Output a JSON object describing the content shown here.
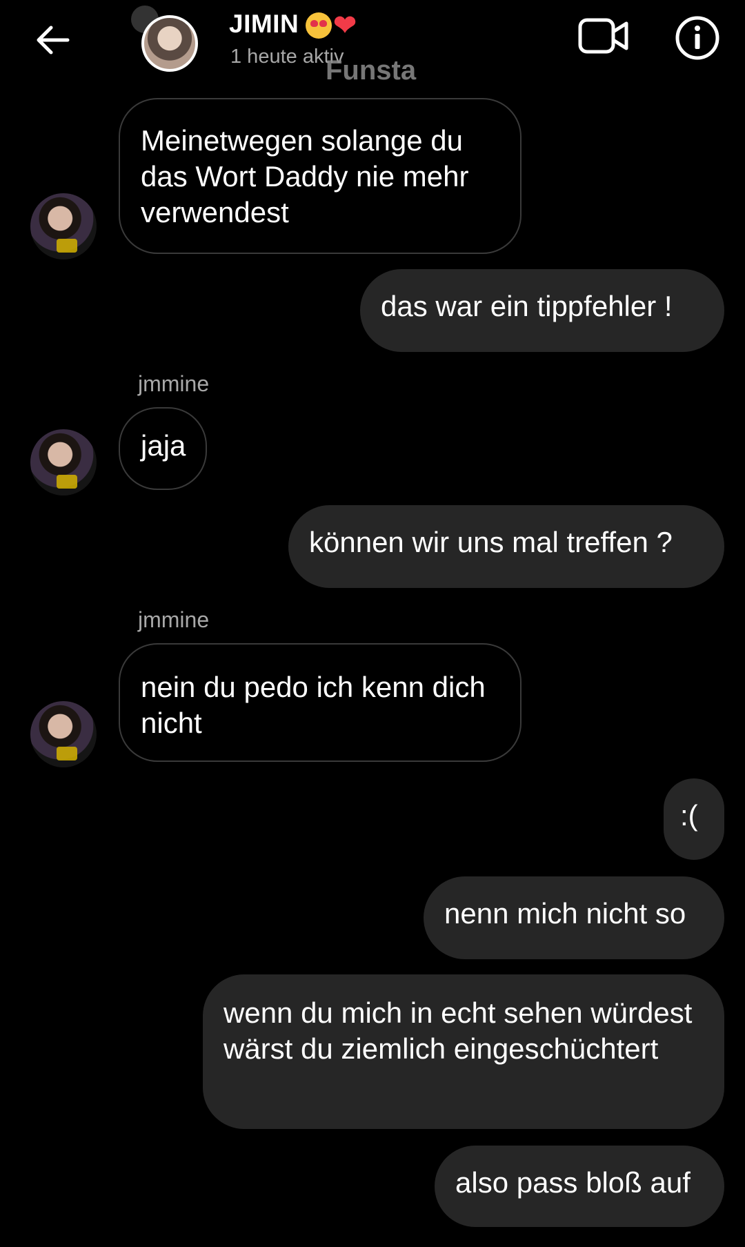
{
  "header": {
    "title": "JIMIN",
    "title_emoji_1": "😍",
    "title_emoji_2": "❤",
    "status": "1 heute aktiv",
    "watermark": "Funsta",
    "icons": [
      "back-arrow-icon",
      "video-call-icon",
      "info-icon"
    ]
  },
  "messages": [
    {
      "id": "m1",
      "direction": "incoming",
      "text": "Meinetwegen solange du das Wort Daddy nie mehr verwendest"
    },
    {
      "id": "m2",
      "direction": "outgoing",
      "text": "das war ein tippfehler !"
    },
    {
      "id": "m3",
      "direction": "incoming",
      "sender": "jmmine",
      "text": "jaja"
    },
    {
      "id": "m4",
      "direction": "outgoing",
      "text": "können wir uns mal treffen ?"
    },
    {
      "id": "m5",
      "direction": "incoming",
      "sender": "jmmine",
      "text": "nein du pedo ich kenn dich nicht"
    },
    {
      "id": "m6",
      "direction": "outgoing",
      "text": ":("
    },
    {
      "id": "m7",
      "direction": "outgoing",
      "text": "nenn mich nicht so"
    },
    {
      "id": "m8",
      "direction": "outgoing",
      "text": "wenn du mich in echt sehen würdest wärst du ziemlich eingeschüchtert"
    },
    {
      "id": "m9",
      "direction": "outgoing",
      "text": "also pass bloß auf"
    }
  ]
}
